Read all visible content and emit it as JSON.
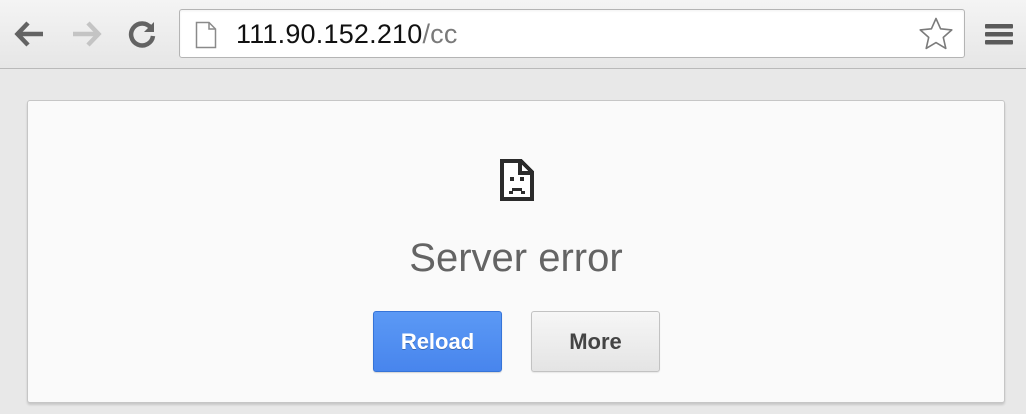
{
  "browser": {
    "toolbar": {
      "back_icon": "arrow-left",
      "forward_icon": "arrow-right",
      "reload_icon": "reload",
      "menu_icon": "hamburger"
    },
    "omnibox": {
      "page_icon": "document",
      "url_host": "111.90.152.210",
      "url_path": "/cc",
      "bookmark_icon": "star-outline"
    }
  },
  "error_page": {
    "icon": "sad-document",
    "title": "Server error",
    "reload_label": "Reload",
    "more_label": "More"
  },
  "colors": {
    "accent_blue": "#4885ed",
    "title_gray": "#646464"
  }
}
